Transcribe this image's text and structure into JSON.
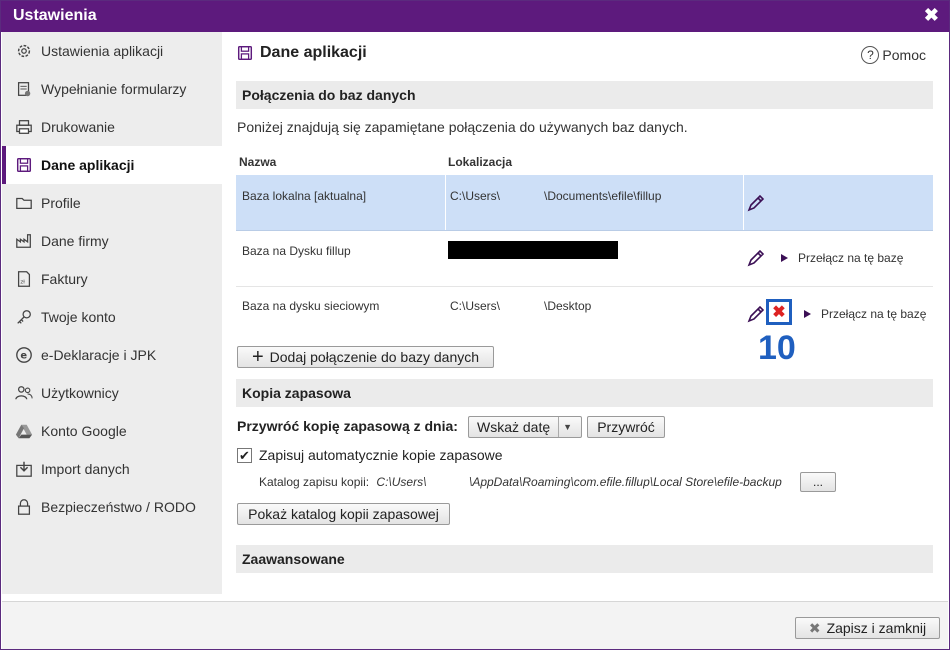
{
  "window": {
    "title": "Ustawienia",
    "close_symbol": "✖"
  },
  "sidebar": {
    "items": [
      {
        "label": "Ustawienia aplikacji",
        "icon": "gear-icon"
      },
      {
        "label": "Wypełnianie formularzy",
        "icon": "form-icon"
      },
      {
        "label": "Drukowanie",
        "icon": "printer-icon"
      },
      {
        "label": "Dane aplikacji",
        "icon": "floppy-icon",
        "active": true
      },
      {
        "label": "Profile",
        "icon": "folder-icon"
      },
      {
        "label": "Dane firmy",
        "icon": "factory-icon"
      },
      {
        "label": "Faktury",
        "icon": "invoice-icon"
      },
      {
        "label": "Twoje konto",
        "icon": "key-icon"
      },
      {
        "label": "e-Deklaracje i JPK",
        "icon": "e-icon"
      },
      {
        "label": "Użytkownicy",
        "icon": "users-icon"
      },
      {
        "label": "Konto Google",
        "icon": "drive-icon"
      },
      {
        "label": "Import danych",
        "icon": "import-icon"
      },
      {
        "label": "Bezpieczeństwo / RODO",
        "icon": "lock-icon"
      }
    ]
  },
  "main": {
    "title": "Dane aplikacji",
    "help_label": "Pomoc",
    "help_symbol": "?",
    "connections": {
      "heading": "Połączenia do baz danych",
      "description": "Poniżej znajdują się zapamiętane połączenia do używanych baz danych.",
      "columns": {
        "name": "Nazwa",
        "location": "Lokalizacja"
      },
      "rows": [
        {
          "name": "Baza lokalna [aktualna]",
          "loc_start": "C:\\Users\\",
          "loc_end": "\\Documents\\efile\\fillup",
          "selected": true
        },
        {
          "name": "Baza na Dysku fillup",
          "loc_redacted": true,
          "switch_label": "Przełącz na tę bazę"
        },
        {
          "name": "Baza na dysku sieciowym",
          "loc_start": "C:\\Users\\",
          "loc_end": "\\Desktop",
          "switch_label": "Przełącz na tę bazę",
          "delete_symbol": "✖"
        }
      ],
      "annotation_number": "10",
      "add_button": "Dodaj połączenie do bazy danych",
      "add_symbol": "+"
    },
    "backup": {
      "heading": "Kopia zapasowa",
      "restore_label": "Przywróć kopię zapasową z dnia:",
      "date_select": "Wskaż datę",
      "restore_button": "Przywróć",
      "auto_label": "Zapisuj automatycznie kopie zapasowe",
      "auto_checked": true,
      "check_symbol": "✔",
      "catalog_label": "Katalog zapisu kopii:",
      "catalog_path_start": "C:\\Users\\",
      "catalog_path_end": "\\AppData\\Roaming\\com.efile.fillup\\Local Store\\efile-backup",
      "browse_button": "...",
      "show_button": "Pokaż katalog kopii zapasowej"
    },
    "advanced": {
      "heading": "Zaawansowane"
    }
  },
  "footer": {
    "save_close": "Zapisz i zamknij",
    "save_symbol": "✖"
  },
  "colors": {
    "accent": "#5d1a7d",
    "selected_row": "#cddff7",
    "annotation": "#1f5fbf"
  }
}
